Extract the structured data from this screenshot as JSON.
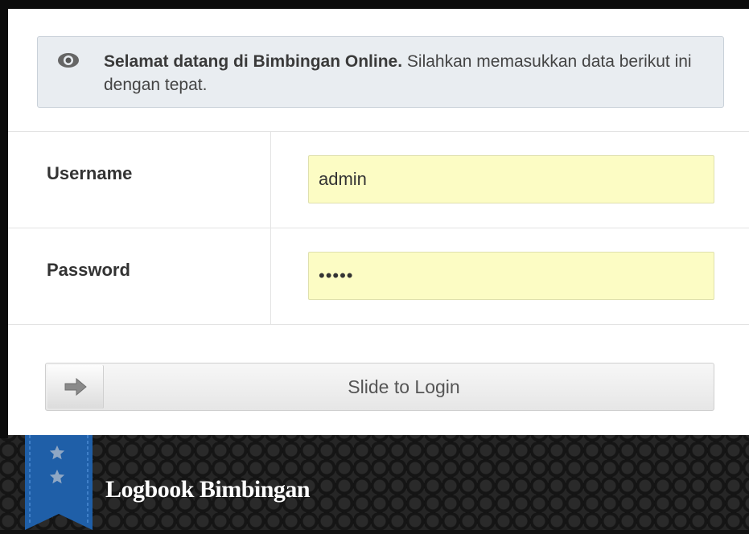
{
  "alert": {
    "icon": "eye-icon",
    "title": "Selamat datang di Bimbingan Online.",
    "message": "Silahkan memasukkan data berikut ini dengan tepat."
  },
  "form": {
    "username_label": "Username",
    "username_value": "admin",
    "password_label": "Password",
    "password_value": "•••••"
  },
  "slider": {
    "icon": "arrow-right-icon",
    "label": "Slide to Login"
  },
  "footer": {
    "ribbon_icons": [
      "star-icon",
      "star-icon"
    ],
    "brand": "Logbook Bimbingan"
  },
  "colors": {
    "input_bg": "#fcfcc4",
    "alert_bg": "#e9edf1",
    "ribbon": "#1f5fa8"
  }
}
